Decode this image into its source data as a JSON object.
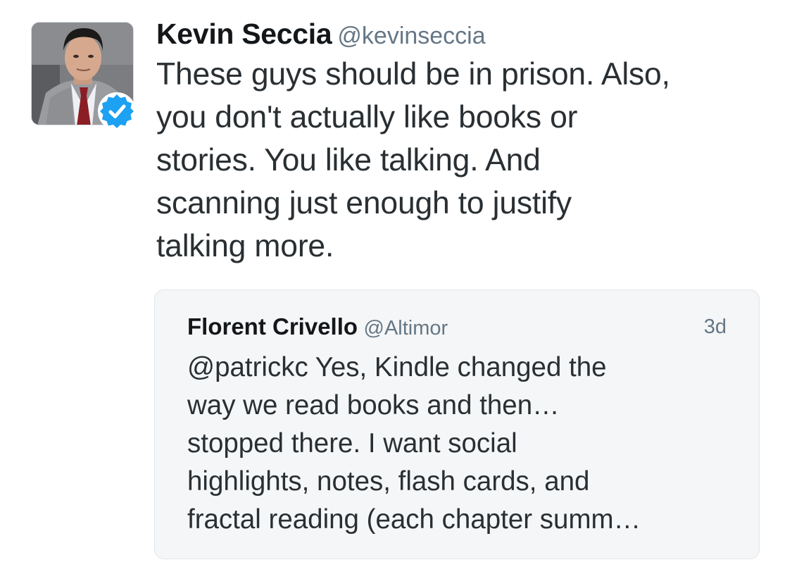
{
  "tweet": {
    "author": {
      "name": "Kevin Seccia",
      "handle": "@kevinseccia",
      "verified": true,
      "avatar_icon": "profile-photo"
    },
    "text_lines": [
      "These guys should be in prison. Also,",
      "you don't actually like books or",
      "stories. You like talking. And",
      "scanning just enough to justify",
      "talking more."
    ]
  },
  "quoted_tweet": {
    "author": {
      "name": "Florent Crivello",
      "handle": "@Altimor"
    },
    "time": "3d",
    "text_lines": [
      "@patrickc Yes, Kindle changed the",
      "way we read books and then…",
      "stopped there. I want social",
      "highlights, notes, flash cards, and",
      "fractal reading (each chapter summ…"
    ]
  },
  "colors": {
    "text": "#292f33",
    "name": "#14171a",
    "secondary": "#657786",
    "verified_blue": "#1da1f2",
    "quote_bg": "#f5f6f7",
    "quote_border": "#e1e5e8"
  }
}
